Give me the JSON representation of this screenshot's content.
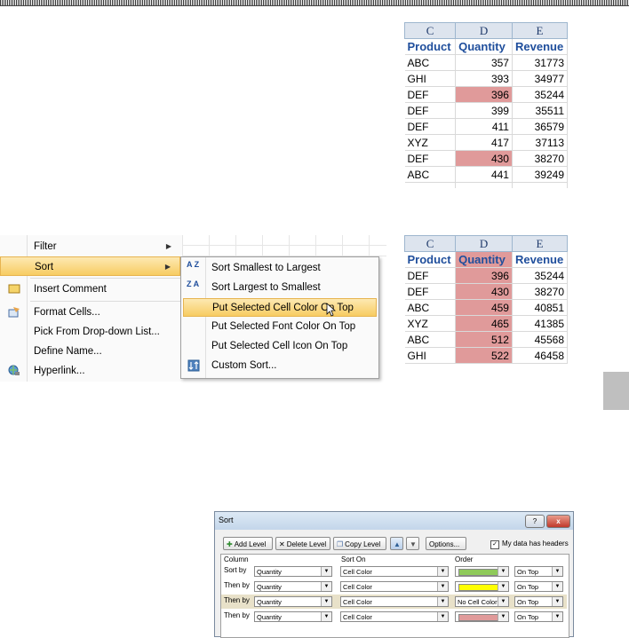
{
  "sheet_top": {
    "columns": [
      "C",
      "D",
      "E"
    ],
    "headers": [
      "Product",
      "Quantity",
      "Revenue"
    ],
    "rows": [
      {
        "product": "ABC",
        "quantity": "357",
        "revenue": "31773",
        "hl": false
      },
      {
        "product": "GHI",
        "quantity": "393",
        "revenue": "34977",
        "hl": false
      },
      {
        "product": "DEF",
        "quantity": "396",
        "revenue": "35244",
        "hl": true
      },
      {
        "product": "DEF",
        "quantity": "399",
        "revenue": "35511",
        "hl": false
      },
      {
        "product": "DEF",
        "quantity": "411",
        "revenue": "36579",
        "hl": false
      },
      {
        "product": "XYZ",
        "quantity": "417",
        "revenue": "37113",
        "hl": false
      },
      {
        "product": "DEF",
        "quantity": "430",
        "revenue": "38270",
        "hl": true
      },
      {
        "product": "ABC",
        "quantity": "441",
        "revenue": "39249",
        "hl": false
      }
    ],
    "highlight_color": "#e09a9a"
  },
  "sheet_bottom": {
    "columns": [
      "C",
      "D",
      "E"
    ],
    "headers": [
      "Product",
      "Quantity",
      "Revenue"
    ],
    "rows": [
      {
        "product": "DEF",
        "quantity": "396",
        "revenue": "35244"
      },
      {
        "product": "DEF",
        "quantity": "430",
        "revenue": "38270"
      },
      {
        "product": "ABC",
        "quantity": "459",
        "revenue": "40851"
      },
      {
        "product": "XYZ",
        "quantity": "465",
        "revenue": "41385"
      },
      {
        "product": "ABC",
        "quantity": "512",
        "revenue": "45568"
      },
      {
        "product": "GHI",
        "quantity": "522",
        "revenue": "46458"
      }
    ]
  },
  "context_menu": {
    "items": [
      {
        "label": "Filter",
        "has_submenu": true,
        "icon": ""
      },
      {
        "label": "Sort",
        "has_submenu": true,
        "selected": true,
        "icon": ""
      },
      {
        "label": "Insert Comment",
        "icon": "comment-icon"
      },
      {
        "label": "Format Cells...",
        "icon": "format-cells-icon"
      },
      {
        "label": "Pick From Drop-down List...",
        "icon": ""
      },
      {
        "label": "Define Name...",
        "icon": ""
      },
      {
        "label": "Hyperlink...",
        "icon": "hyperlink-globe-icon"
      }
    ]
  },
  "sort_submenu": {
    "items": [
      {
        "label": "Sort Smallest to Largest",
        "icon": "sort-ascending-icon",
        "icon_text": "A Z"
      },
      {
        "label": "Sort Largest to Smallest",
        "icon": "sort-descending-icon",
        "icon_text": "Z A"
      },
      {
        "label": "Put Selected Cell Color On Top",
        "icon": "",
        "selected": true
      },
      {
        "label": "Put Selected Font Color On Top",
        "icon": ""
      },
      {
        "label": "Put Selected Cell Icon On Top",
        "icon": ""
      },
      {
        "label": "Custom Sort...",
        "icon": "custom-sort-icon"
      }
    ]
  },
  "sort_dialog": {
    "title": "Sort",
    "help": "?",
    "close": "x",
    "buttons": {
      "add_level": "Add Level",
      "delete_level": "Delete Level",
      "copy_level": "Copy Level",
      "move_up": "▲",
      "move_down": "▼",
      "options": "Options..."
    },
    "headers_checkbox": {
      "checked": "✓",
      "label": "My data has headers"
    },
    "col_headers": {
      "column": "Column",
      "sort_on": "Sort On",
      "order": "Order"
    },
    "rows": [
      {
        "label": "Sort by",
        "column": "Quantity",
        "sort_on": "Cell Color",
        "color": "#8fca5a",
        "color_text": "",
        "order": "On Top",
        "highlight": false
      },
      {
        "label": "Then by",
        "column": "Quantity",
        "sort_on": "Cell Color",
        "color": "#ffff00",
        "color_text": "",
        "order": "On Top",
        "highlight": false
      },
      {
        "label": "Then by",
        "column": "Quantity",
        "sort_on": "Cell Color",
        "color": "",
        "color_text": "No Cell Color",
        "order": "On Top",
        "highlight": true
      },
      {
        "label": "Then by",
        "column": "Quantity",
        "sort_on": "Cell Color",
        "color": "#e09a9a",
        "color_text": "",
        "order": "On Top",
        "highlight": false
      }
    ]
  }
}
